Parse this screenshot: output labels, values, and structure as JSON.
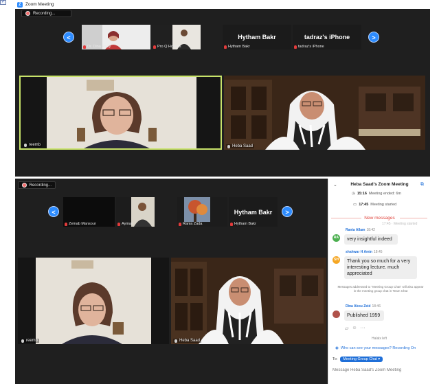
{
  "top_window": {
    "title": "Zoom Meeting",
    "recording_label": "Recording...",
    "nav_prev": "<",
    "nav_next": ">",
    "thumbnails": [
      {
        "name": "Dr. Dina Rady"
      },
      {
        "name": "Pro Q Holmes"
      },
      {
        "name": "Hytham Bakr",
        "display": "Hytham Bakr"
      },
      {
        "name": "tadraz's iPhone",
        "display": "tadraz's iPhone"
      }
    ],
    "tiles": [
      {
        "name": "reemb"
      },
      {
        "name": "Heba Saad"
      }
    ]
  },
  "bottom_window": {
    "recording_label": "Recording...",
    "nav_prev": "<",
    "nav_next": ">",
    "thumbnails": [
      {
        "name": "Zeinab Mansour"
      },
      {
        "name": "Ayman"
      },
      {
        "name": "Rania Zada"
      },
      {
        "name": "Hytham Bakr",
        "display": "Hytham Bakr"
      }
    ],
    "tiles": [
      {
        "name": "reemb"
      },
      {
        "name": "Heba Saad"
      }
    ]
  },
  "chat": {
    "header": "Heba Saad's Zoom Meeting",
    "sys1_time": "15:16",
    "sys1_text": "Meeting ended: 6m",
    "sys2_time": "17:45",
    "sys2_text": "Meeting started",
    "new_messages": "New messages",
    "faded_sys": "17:45 · Meeting started",
    "messages": [
      {
        "initials": "RA",
        "sender": "Rania Allam",
        "time": "18:42",
        "text": "very insightful indeed"
      },
      {
        "initials": "SH",
        "sender": "shahwar H Amin",
        "time": "18:45",
        "text": "Thank you so much for a very interesting lecture. much appreciated"
      },
      {
        "initials": "",
        "sender": "Dina Abou Zeid",
        "time": "18:46",
        "text": "Published 1959"
      }
    ],
    "note": "Messages addressed to \"Meeting Group Chat\" will also appear in the meeting group chat in Team Chat",
    "left_notice": "Halalx left",
    "who_can_see": "Who can see your messages? Recording On",
    "to_label": "To:",
    "to_value": "Meeting Group Chat",
    "input_placeholder": "Message Heba Saad's Zoom Meeting"
  },
  "colors": {
    "zoom_blue": "#2d8cff",
    "active_speaker": "#c8e36a",
    "new_message_red": "#e0453d",
    "avatar_ra": "#4caf50",
    "avatar_sh": "#f5a623"
  }
}
